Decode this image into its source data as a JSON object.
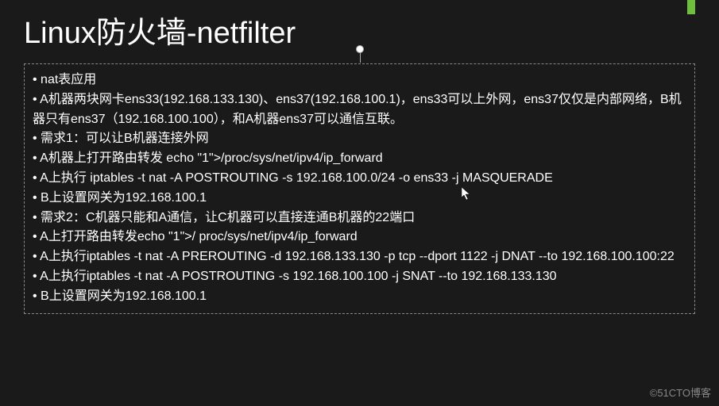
{
  "slide": {
    "title": "Linux防火墙-netfilter",
    "bullets": [
      "nat表应用",
      "A机器两块网卡ens33(192.168.133.130)、ens37(192.168.100.1)，ens33可以上外网，ens37仅仅是内部网络，B机器只有ens37（192.168.100.100），和A机器ens37可以通信互联。",
      "需求1：可以让B机器连接外网",
      "A机器上打开路由转发 echo \"1\">/proc/sys/net/ipv4/ip_forward",
      "A上执行 iptables -t nat -A POSTROUTING -s 192.168.100.0/24 -o ens33 -j MASQUERADE",
      "B上设置网关为192.168.100.1",
      "需求2：C机器只能和A通信，让C机器可以直接连通B机器的22端口",
      "A上打开路由转发echo \"1\">/ proc/sys/net/ipv4/ip_forward",
      " A上执行iptables -t nat -A PREROUTING -d 192.168.133.130 -p tcp --dport 1122 -j DNAT --to 192.168.100.100:22",
      " A上执行iptables -t nat -A POSTROUTING -s 192.168.100.100 -j SNAT --to 192.168.133.130",
      "B上设置网关为192.168.100.1"
    ]
  },
  "watermark": "©51CTO博客",
  "icons": {
    "cursor": "↖"
  }
}
